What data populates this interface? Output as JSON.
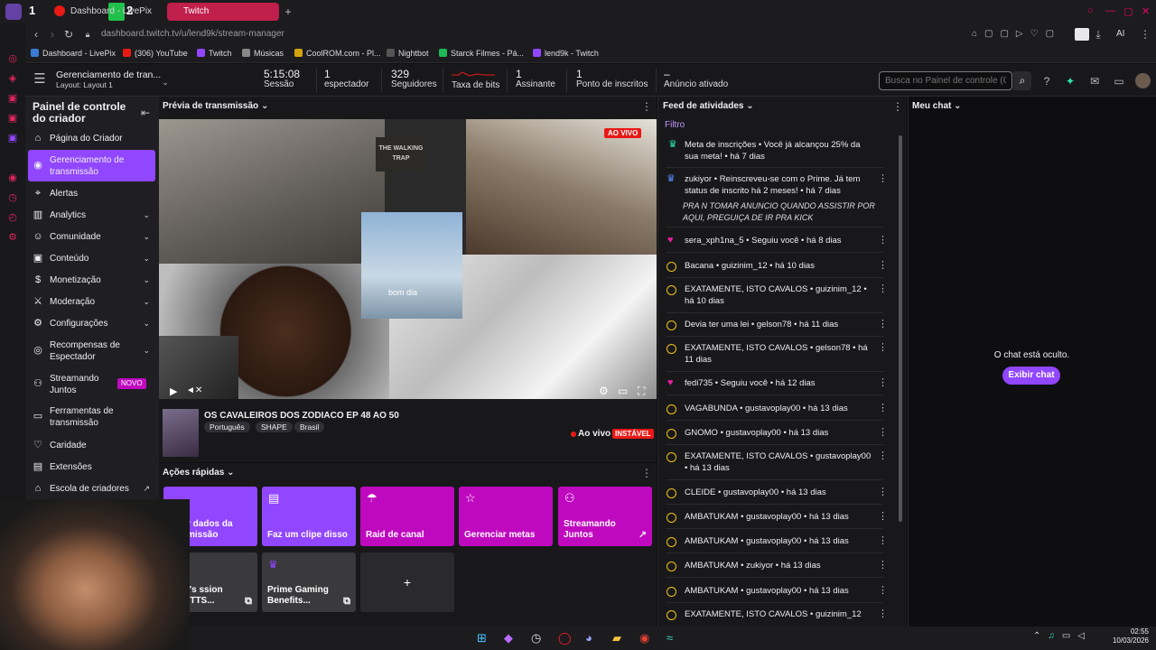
{
  "browser": {
    "tabs": {
      "dashboard": "Dashboard - LivePix",
      "twitch": "Twitch",
      "new_tab": "+"
    },
    "url": "dashboard.twitch.tv/u/lend9k/stream-manager",
    "bookmarks": [
      "Dashboard - LivePix",
      "(306) YouTube",
      "Twitch",
      "Músicas",
      "CoolROM.com - Pl...",
      "Nightbot",
      "Starck Filmes - Pá...",
      "lend9k - Twitch"
    ],
    "ai_label": "AI"
  },
  "header": {
    "title": "Gerenciamento de tran...",
    "layout": "Layout: Layout 1",
    "stats": [
      {
        "value": "5:15:08",
        "label": "Sessão"
      },
      {
        "value": "1",
        "label": "espectador"
      },
      {
        "value": "329",
        "label": "Seguidores"
      },
      {
        "value": "",
        "label": "Taxa de bits"
      },
      {
        "value": "1",
        "label": "Assinante"
      },
      {
        "value": "1",
        "label": "Ponto de inscritos"
      },
      {
        "value": "–",
        "label": "Anúncio ativado"
      }
    ],
    "search_placeholder": "Busca no Painel de controle (C"
  },
  "sidebar": {
    "title": "Painel de controle do criador",
    "items": [
      {
        "label": "Página do Criador"
      },
      {
        "label": "Gerenciamento de transmissão"
      },
      {
        "label": "Alertas"
      },
      {
        "label": "Analytics"
      },
      {
        "label": "Comunidade"
      },
      {
        "label": "Conteúdo"
      },
      {
        "label": "Monetização"
      },
      {
        "label": "Moderação"
      },
      {
        "label": "Configurações"
      },
      {
        "label": "Recompensas de Espectador"
      },
      {
        "label": "Streamando Juntos",
        "badge": "NOVO"
      },
      {
        "label": "Ferramentas de transmissão"
      },
      {
        "label": "Caridade"
      },
      {
        "label": "Extensões"
      },
      {
        "label": "Escola de criadores"
      }
    ]
  },
  "preview": {
    "header": "Prévia de transmissão",
    "live_badge": "AO VIVO",
    "overlay_text": "bom dia",
    "stream_title": "OS CAVALEIROS DOS ZODIACO EP 48 AO 50",
    "tags": [
      "Português",
      "SHAPE",
      "Brasil"
    ],
    "status": "Ao vivo",
    "health": "INSTÁVEL",
    "video_texts": [
      "THE WALKING",
      "TRAP"
    ]
  },
  "quick_actions": {
    "header": "Ações rápidas",
    "items": [
      {
        "label": "r dados da missão",
        "color": "#9146ff"
      },
      {
        "label": "Faz um clipe disso",
        "color": "#9146ff"
      },
      {
        "label": "Raid de canal",
        "color": "#bf09bf"
      },
      {
        "label": "Gerenciar metas",
        "color": "#bf09bf"
      },
      {
        "label": "Streamando Juntos",
        "color": "#bf09bf"
      },
      {
        "label": "i's ssion (TTS...",
        "color": "#3a3a3d"
      },
      {
        "label": "Prime Gaming Benefits...",
        "color": "#3a3a3d"
      },
      {
        "label": "+",
        "color": "#2a2a2d"
      }
    ]
  },
  "feed": {
    "header": "Feed de atividades",
    "filter": "Filtro",
    "items": [
      {
        "text": "Meta de inscrições • Você já alcançou 25% da sua meta! • há 7 dias",
        "icon": "trophy-icon"
      },
      {
        "text": "zukiyor • Reinscreveu-se com o Prime. Já tem status de inscrito há 2 meses! • há 7 dias",
        "icon": "crown-icon"
      },
      {
        "text": "PRA N TOMAR ANUNCIO QUANDO ASSISTIR POR AQUI, PREGUIÇA DE IR PRA KICK",
        "icon": ""
      },
      {
        "text": "sera_xph1na_5 • Seguiu você • há 8 dias",
        "icon": "heart-icon"
      },
      {
        "text": "Bacana • guizinim_12 • há 10 dias",
        "icon": "points-icon"
      },
      {
        "text": "EXATAMENTE, ISTO CAVALOS • guizinim_12 • há 10 dias",
        "icon": "points-icon"
      },
      {
        "text": "Devia ter uma lei • gelson78 • há 11 dias",
        "icon": "points-icon"
      },
      {
        "text": "EXATAMENTE, ISTO CAVALOS • gelson78 • há 11 dias",
        "icon": "points-icon"
      },
      {
        "text": "fedi735 • Seguiu você • há 12 dias",
        "icon": "heart-icon"
      },
      {
        "text": "VAGABUNDA • gustavoplay00 • há 13 dias",
        "icon": "points-icon"
      },
      {
        "text": "GNOMO • gustavoplay00 • há 13 dias",
        "icon": "points-icon"
      },
      {
        "text": "EXATAMENTE, ISTO CAVALOS • gustavoplay00 • há 13 dias",
        "icon": "points-icon"
      },
      {
        "text": "CLEIDE • gustavoplay00 • há 13 dias",
        "icon": "points-icon"
      },
      {
        "text": "AMBATUKAM • gustavoplay00 • há 13 dias",
        "icon": "points-icon"
      },
      {
        "text": "AMBATUKAM • gustavoplay00 • há 13 dias",
        "icon": "points-icon"
      },
      {
        "text": "AMBATUKAM • zukiyor • há 13 dias",
        "icon": "points-icon"
      },
      {
        "text": "AMBATUKAM • gustavoplay00 • há 13 dias",
        "icon": "points-icon"
      },
      {
        "text": "EXATAMENTE, ISTO CAVALOS • guizinim_12",
        "icon": "points-icon"
      }
    ]
  },
  "chat": {
    "header": "Meu chat",
    "hidden_text": "O chat está oculto.",
    "show_button": "Exibir chat"
  },
  "taskbar": {
    "time": "02:55",
    "date": "10/03/2026"
  },
  "colors": {
    "accent": "#9146ff",
    "live": "#e91916",
    "magenta": "#bf09bf"
  }
}
